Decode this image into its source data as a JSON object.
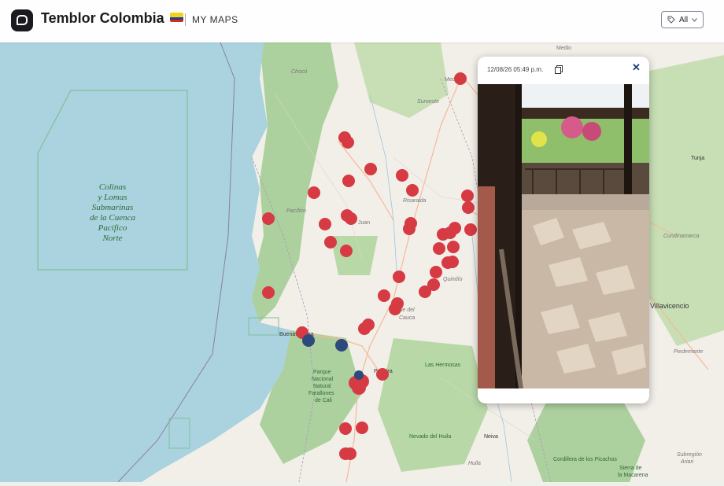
{
  "header": {
    "title": "Temblor Colombia",
    "section": "MY MAPS",
    "filter_label": "All"
  },
  "popup": {
    "timestamp": "12/08/26 05:49 p.m."
  },
  "map": {
    "sea_feature_lines": [
      "Colinas",
      "y Lomas",
      "Submarinas",
      "de la Cuenca",
      "Pacífico",
      "Norte"
    ],
    "place_labels": [
      "Chocó",
      "Medellín",
      "Suroeste",
      "Risaralda",
      "Pacífico",
      "Juan",
      "Quindío",
      "Valle del",
      "Cauca",
      "Buenaventura",
      "Palmira",
      "Parque",
      "Nacional",
      "Natural",
      "Farallones",
      "de Cali",
      "Las Hermosas",
      "Nevado del Huila",
      "Neiva",
      "Huila",
      "Villavicencio",
      "Tunja",
      "Cundinamarca",
      "Piedemonte",
      "Medio",
      "Cordillera de los Picachos",
      "Sierra de",
      "la Macarena",
      "Subregión",
      "Ariari"
    ],
    "colors": {
      "sea": "#aad3df",
      "land": "#f2efe9",
      "forest": "#add19e",
      "report_marker": "#d63a43",
      "other_marker": "#2c4a7c"
    },
    "red_markers": 52,
    "blue_markers": 3
  }
}
